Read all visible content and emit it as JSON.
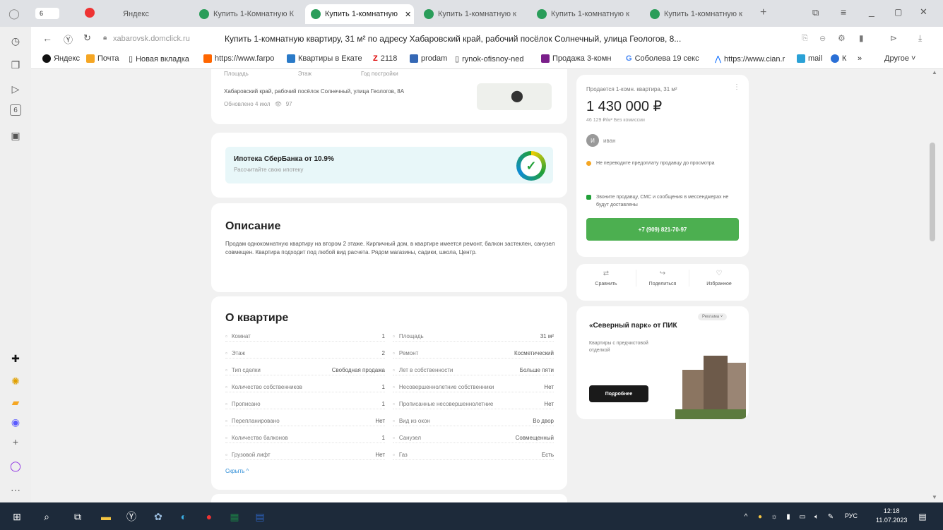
{
  "tabs": {
    "counter": "6",
    "yandex": "Яндекс",
    "t1": "Купить 1-Комнатную К",
    "t2": "Купить 1-комнатную",
    "t3": "Купить 1-комнатную к",
    "t4": "Купить 1-комнатную к",
    "t5": "Купить 1-комнатную к"
  },
  "address": {
    "domain": "xabarovsk.domclick.ru",
    "title": "Купить 1-комнатную квартиру, 31 м² по адресу Хабаровский край, рабочий посёлок Солнечный, улица Геологов, 8..."
  },
  "bookmarks": [
    "Яндекс",
    "Почта",
    "Новая вкладка",
    "https://www.farpo",
    "Квартиры в Екате",
    "2118",
    "prodam",
    "rynok-ofisnoy-ned",
    "Продажа 3-комн",
    "Соболева 19 секс",
    "https://www.cian.r",
    "mail",
    "К",
    "»",
    "Другое ˅"
  ],
  "listing": {
    "top_labels": [
      "Площадь",
      "Этаж",
      "Год постройки"
    ],
    "address": "Хабаровский край, рабочий посёлок Солнечный, улица Геологов, 8А",
    "updated": "Обновлено 4 июл",
    "views": "97"
  },
  "mortgage": {
    "title": "Ипотека СберБанка от 10.9%",
    "subtitle": "Рассчитайте свою ипотеку"
  },
  "description": {
    "heading": "Описание",
    "text": "Продам однокомнатную квартиру на втором 2 этаже. Кирпичный дом, в квартире имеется ремонт, балкон застеклен, санузел совмещен. Квартира подходит под любой вид расчета. Рядом магазины, садики, школа, Центр."
  },
  "about": {
    "heading": "О квартире",
    "left": [
      {
        "label": "Комнат",
        "value": "1"
      },
      {
        "label": "Этаж",
        "value": "2"
      },
      {
        "label": "Тип сделки",
        "value": "Свободная продажа"
      },
      {
        "label": "Количество собственников",
        "value": "1"
      },
      {
        "label": "Прописано",
        "value": "1"
      },
      {
        "label": "Перепланировано",
        "value": "Нет"
      },
      {
        "label": "Количество балконов",
        "value": "1"
      },
      {
        "label": "Грузовой лифт",
        "value": "Нет"
      }
    ],
    "right": [
      {
        "label": "Площадь",
        "value": "31 м²"
      },
      {
        "label": "Ремонт",
        "value": "Косметический"
      },
      {
        "label": "Лет в собственности",
        "value": "Больше пяти"
      },
      {
        "label": "Несовершеннолетние собственники",
        "value": "Нет"
      },
      {
        "label": "Прописанные несовершеннолетние",
        "value": "Нет"
      },
      {
        "label": "Вид из окон",
        "value": "Во двор"
      },
      {
        "label": "Санузел",
        "value": "Совмещенный"
      },
      {
        "label": "Газ",
        "value": "Есть"
      }
    ],
    "collapse": "Скрыть ^"
  },
  "price_card": {
    "label": "Продается 1-комн. квартира, 31 м²",
    "price": "1 430 000 ₽",
    "per_meter": "46 129 ₽/м²   Без комиссии",
    "seller_initial": "И",
    "seller_name": "иван",
    "warn1": "Не переводите предоплату продавцу до просмотра",
    "warn2": "Звоните продавцу, СМС и сообщения в мессенджерах не будут доставлены",
    "phone": "+7 (909) 821-70-97"
  },
  "actions": {
    "compare": "Сравнить",
    "share": "Поделиться",
    "favorite": "Избранное"
  },
  "ad": {
    "badge": "Реклама ˅",
    "title": "«Северный парк» от ПИК",
    "subtitle": "Квартиры с предчистовой отделкой",
    "button": "Подробнее"
  },
  "tray": {
    "lang": "РУС",
    "time": "12:18",
    "date": "11.07.2023"
  },
  "colors": {
    "green": "#4caf50",
    "tabbar": "#dfe1e5",
    "taskbar": "#1d2a3a"
  }
}
